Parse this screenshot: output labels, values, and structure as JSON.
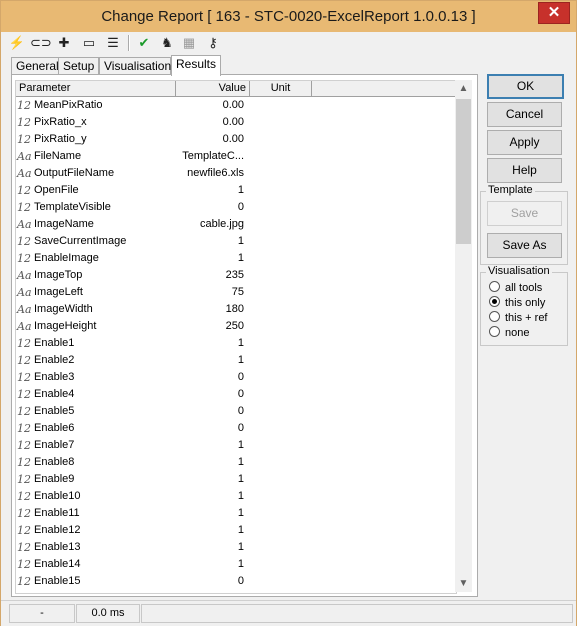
{
  "window": {
    "title": "Change Report [ 163 - STC-0020-ExcelReport 1.0.0.13 ]",
    "close_glyph": "✕"
  },
  "toolbar": {
    "icons": [
      {
        "name": "lightning-icon",
        "glyph": "⚡"
      },
      {
        "name": "link-icon",
        "glyph": "⊂⊃"
      },
      {
        "name": "puzzle-icon",
        "glyph": "✚"
      },
      {
        "name": "console-icon",
        "glyph": "▭"
      },
      {
        "name": "list-icon",
        "glyph": "☰"
      },
      {
        "name": "checkmark-icon",
        "glyph": "✔"
      },
      {
        "name": "run-icon",
        "glyph": "♞"
      },
      {
        "name": "chart-icon",
        "glyph": "▦"
      },
      {
        "name": "key-icon",
        "glyph": "⚷"
      }
    ]
  },
  "tabs": [
    "General",
    "Setup",
    "Visualisation",
    "Results"
  ],
  "active_tab": "Results",
  "grid": {
    "columns": [
      "Parameter",
      "Value",
      "Unit"
    ],
    "rows": [
      {
        "type": "12",
        "name": "MeanPixRatio",
        "value": "0.00"
      },
      {
        "type": "12",
        "name": "PixRatio_x",
        "value": "0.00"
      },
      {
        "type": "12",
        "name": "PixRatio_y",
        "value": "0.00"
      },
      {
        "type": "Aa",
        "name": "FileName",
        "value": "TemplateC..."
      },
      {
        "type": "Aa",
        "name": "OutputFileName",
        "value": "newfile6.xls"
      },
      {
        "type": "12",
        "name": "OpenFile",
        "value": "1"
      },
      {
        "type": "12",
        "name": "TemplateVisible",
        "value": "0"
      },
      {
        "type": "Aa",
        "name": "ImageName",
        "value": "cable.jpg"
      },
      {
        "type": "12",
        "name": "SaveCurrentImage",
        "value": "1"
      },
      {
        "type": "12",
        "name": "EnableImage",
        "value": "1"
      },
      {
        "type": "Aa",
        "name": "ImageTop",
        "value": "235"
      },
      {
        "type": "Aa",
        "name": "ImageLeft",
        "value": "75"
      },
      {
        "type": "Aa",
        "name": "ImageWidth",
        "value": "180"
      },
      {
        "type": "Aa",
        "name": "ImageHeight",
        "value": "250"
      },
      {
        "type": "12",
        "name": "Enable1",
        "value": "1"
      },
      {
        "type": "12",
        "name": "Enable2",
        "value": "1"
      },
      {
        "type": "12",
        "name": "Enable3",
        "value": "0"
      },
      {
        "type": "12",
        "name": "Enable4",
        "value": "0"
      },
      {
        "type": "12",
        "name": "Enable5",
        "value": "0"
      },
      {
        "type": "12",
        "name": "Enable6",
        "value": "0"
      },
      {
        "type": "12",
        "name": "Enable7",
        "value": "1"
      },
      {
        "type": "12",
        "name": "Enable8",
        "value": "1"
      },
      {
        "type": "12",
        "name": "Enable9",
        "value": "1"
      },
      {
        "type": "12",
        "name": "Enable10",
        "value": "1"
      },
      {
        "type": "12",
        "name": "Enable11",
        "value": "1"
      },
      {
        "type": "12",
        "name": "Enable12",
        "value": "1"
      },
      {
        "type": "12",
        "name": "Enable13",
        "value": "1"
      },
      {
        "type": "12",
        "name": "Enable14",
        "value": "1"
      },
      {
        "type": "12",
        "name": "Enable15",
        "value": "0"
      }
    ]
  },
  "buttons": {
    "ok": "OK",
    "cancel": "Cancel",
    "apply": "Apply",
    "help": "Help"
  },
  "template_group": {
    "label": "Template",
    "save": "Save",
    "save_as": "Save As"
  },
  "visualisation_group": {
    "label": "Visualisation",
    "options": [
      "all tools",
      "this only",
      "this + ref",
      "none"
    ],
    "selected": "this only"
  },
  "scrollbar": {
    "up_glyph": "▲",
    "down_glyph": "▼"
  },
  "statusbar": {
    "field1": "-",
    "field2": "0.0 ms"
  }
}
